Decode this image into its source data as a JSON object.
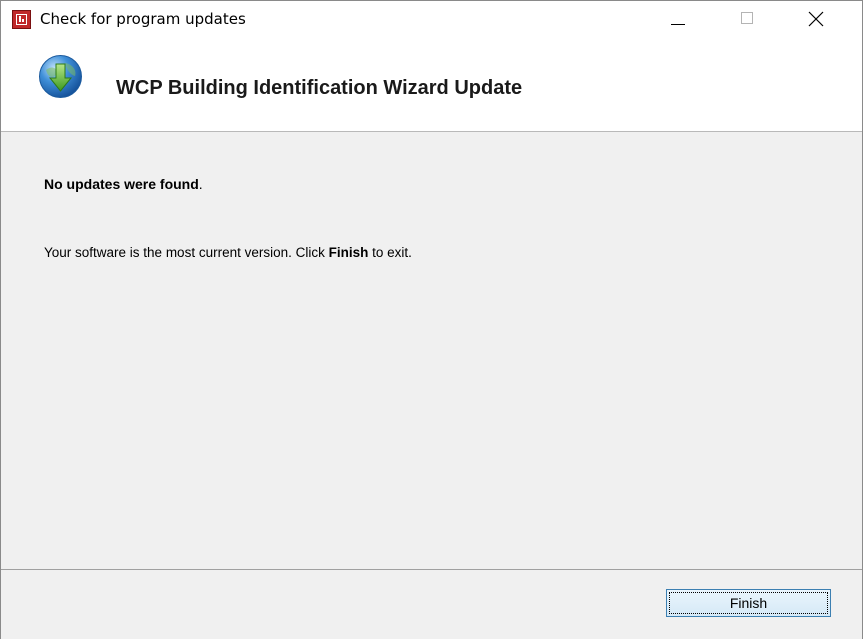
{
  "window": {
    "title": "Check for program updates",
    "icon": "app-logo-icon",
    "controls": {
      "minimize": "minimize-icon",
      "maximize": "maximize-icon",
      "close": "close-icon"
    }
  },
  "header": {
    "icon": "globe-download-icon",
    "title": "WCP Building Identification Wizard Update"
  },
  "body": {
    "status_bold": "No updates were found",
    "status_end": ".",
    "message_pre": "Your software is the most current version. Click ",
    "message_bold": "Finish",
    "message_post": " to exit."
  },
  "footer": {
    "finish_label": "Finish"
  },
  "colors": {
    "app_icon": "#c0282a",
    "button_border": "#3c7fb1",
    "background": "#f0f0f0"
  }
}
